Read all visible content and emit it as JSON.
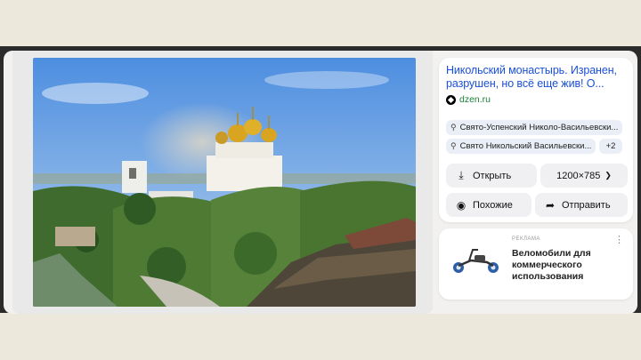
{
  "article": {
    "title": "Никольский монастырь. Изранен, разрушен, но всё еще жив! О...",
    "source": "dzen.ru"
  },
  "tags": [
    {
      "label": "Свято-Успенский Николо-Васильевски..."
    },
    {
      "label": "Свято Никольский Васильевски..."
    }
  ],
  "tags_more": "+2",
  "actions": {
    "open_label": "Открыть",
    "size_label": "1200×785",
    "similar_label": "Похожие",
    "send_label": "Отправить"
  },
  "ad": {
    "label": "РЕКЛАМА",
    "text": "Веломобили для коммерческого использования"
  },
  "colors": {
    "title_link": "#1a4fd8",
    "source_green": "#1a7f37",
    "tag_bg": "#eaeef6"
  }
}
